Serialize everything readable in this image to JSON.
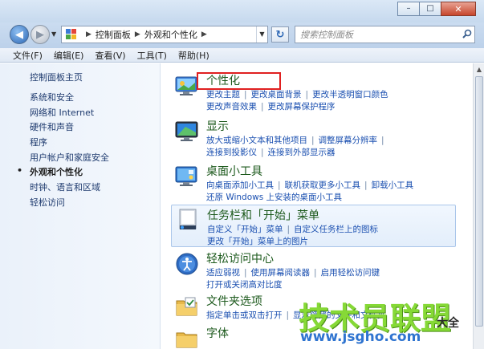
{
  "window": {
    "minimize_glyph": "–",
    "maximize_glyph": "□",
    "close_glyph": "✕"
  },
  "nav": {
    "back_glyph": "◀",
    "forward_glyph": "▶",
    "breadcrumb": [
      "控制面板",
      "外观和个性化"
    ],
    "refresh_glyph": "↻",
    "search_placeholder": "搜索控制面板"
  },
  "menubar": {
    "items": [
      "文件(F)",
      "编辑(E)",
      "查看(V)",
      "工具(T)",
      "帮助(H)"
    ]
  },
  "sidebar": {
    "home": "控制面板主页",
    "items": [
      {
        "label": "系统和安全",
        "active": false
      },
      {
        "label": "网络和 Internet",
        "active": false
      },
      {
        "label": "硬件和声音",
        "active": false
      },
      {
        "label": "程序",
        "active": false
      },
      {
        "label": "用户帐户和家庭安全",
        "active": false
      },
      {
        "label": "外观和个性化",
        "active": true
      },
      {
        "label": "时钟、语言和区域",
        "active": false
      },
      {
        "label": "轻松访问",
        "active": false
      }
    ]
  },
  "sections": [
    {
      "title": "个性化",
      "icon": "personalization-icon",
      "rows": [
        [
          "更改主题",
          "更改桌面背景",
          "更改半透明窗口颜色"
        ],
        [
          "更改声音效果",
          "更改屏幕保护程序"
        ]
      ]
    },
    {
      "title": "显示",
      "icon": "display-icon",
      "rows": [
        [
          "放大或缩小文本和其他项目",
          "调整屏幕分辨率"
        ],
        [
          "连接到投影仪",
          "连接到外部显示器"
        ]
      ]
    },
    {
      "title": "桌面小工具",
      "icon": "gadgets-icon",
      "rows": [
        [
          "向桌面添加小工具",
          "联机获取更多小工具",
          "卸载小工具"
        ],
        [
          "还原 Windows 上安装的桌面小工具"
        ]
      ]
    },
    {
      "title": "任务栏和「开始」菜单",
      "icon": "taskbar-icon",
      "rows": [
        [
          "自定义「开始」菜单",
          "自定义任务栏上的图标"
        ],
        [
          "更改「开始」菜单上的图片"
        ]
      ]
    },
    {
      "title": "轻松访问中心",
      "icon": "ease-of-access-icon",
      "rows": [
        [
          "适应弱视",
          "使用屏幕阅读器",
          "启用轻松访问键"
        ],
        [
          "打开或关闭高对比度"
        ]
      ]
    },
    {
      "title": "文件夹选项",
      "icon": "folder-options-icon",
      "rows": [
        [
          "指定单击或双击打开",
          "显示隐藏的文件和文件夹"
        ]
      ]
    },
    {
      "title": "字体",
      "icon": "fonts-icon",
      "rows": []
    }
  ],
  "watermark": {
    "brand": "技术员联盟",
    "url": "www.jsgho.com",
    "side": "大全"
  }
}
